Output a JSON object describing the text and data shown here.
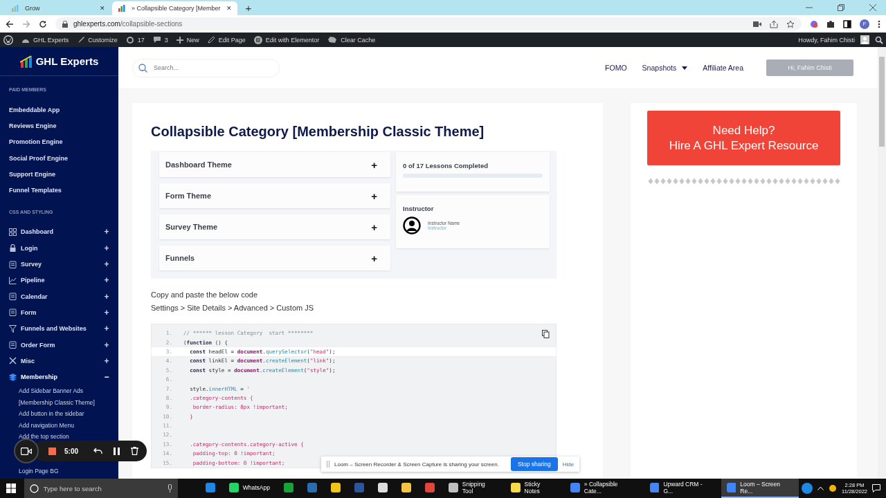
{
  "browser": {
    "tabs": [
      {
        "title": "Grow",
        "close": "✕",
        "selected": false
      },
      {
        "title": "» Collapsible Category [Member",
        "close": "✕",
        "selected": true
      }
    ],
    "new_tab": "+",
    "url": {
      "host": "ghlexperts.com",
      "path": "/collapsible-sections"
    },
    "profile_initial": "F"
  },
  "admin_bar": {
    "items": [
      {
        "label": "GHL Experts"
      },
      {
        "label": "Customize"
      },
      {
        "label": "17"
      },
      {
        "label": "3"
      },
      {
        "label": "New"
      },
      {
        "label": "Edit Page"
      },
      {
        "label": "Edit with Elementor"
      },
      {
        "label": "Clear Cache"
      }
    ],
    "greeting": "Howdy, Fahim Chisti"
  },
  "sidebar": {
    "logo": "GHL Experts",
    "sections": [
      {
        "heading": "PAID MEMBERS",
        "items": [
          {
            "label": "Embeddable App",
            "selected": false
          },
          {
            "label": "Reviews Engine",
            "selected": false
          },
          {
            "label": "Promotion Engine",
            "selected": false
          },
          {
            "label": "Social Proof Engine",
            "selected": false
          },
          {
            "label": "Support Engine",
            "selected": false
          },
          {
            "label": "Funnel Templates",
            "selected": false
          }
        ]
      },
      {
        "heading": "CSS AND STYLING",
        "items": [
          {
            "label": "Dashboard",
            "selected": false,
            "expanded": false,
            "toggle": "+"
          },
          {
            "label": "Login",
            "selected": false,
            "expanded": false,
            "toggle": "+"
          },
          {
            "label": "Survey",
            "selected": false,
            "expanded": false,
            "toggle": "+"
          },
          {
            "label": "Pipeline",
            "selected": false,
            "expanded": false,
            "toggle": "+"
          },
          {
            "label": "Calendar",
            "selected": false,
            "expanded": false,
            "toggle": "+"
          },
          {
            "label": "Form",
            "selected": false,
            "expanded": false,
            "toggle": "+"
          },
          {
            "label": "Funnels and Websites",
            "selected": false,
            "expanded": false,
            "toggle": "+"
          },
          {
            "label": "Order Form",
            "selected": false,
            "expanded": false,
            "toggle": "+"
          },
          {
            "label": "Misc",
            "selected": false,
            "expanded": false,
            "toggle": "+"
          },
          {
            "label": "Membership",
            "selected": true,
            "expanded": true,
            "toggle": "−",
            "children": [
              {
                "label": "Add Sidebar Banner Ads"
              },
              {
                "label": "[Membership Classic Theme]"
              },
              {
                "label": "Add button in the sidebar"
              },
              {
                "label": "Add navigation Menu"
              },
              {
                "label": "Add the top section"
              }
            ],
            "more": [
              {
                "label": "Login Page BG"
              }
            ]
          }
        ]
      }
    ]
  },
  "header": {
    "search": {
      "placeholder": "Search..."
    },
    "nav": [
      {
        "label": "FOMO",
        "dropdown": false
      },
      {
        "label": "Snapshots",
        "dropdown": true
      },
      {
        "label": "Affiliate Area",
        "dropdown": false
      }
    ],
    "account_button": {
      "label": "Hi, Fahim Chisti",
      "disabled": true
    }
  },
  "article": {
    "title": "Collapsible Category [Membership Classic Theme]",
    "preview": {
      "categories": [
        {
          "label": "Dashboard Theme",
          "toggle": "+"
        },
        {
          "label": "Form Theme",
          "toggle": "+"
        },
        {
          "label": "Survey Theme",
          "toggle": "+"
        },
        {
          "label": "Funnels",
          "toggle": "+"
        }
      ],
      "progress": {
        "label": "0 of 17 Lessons Completed",
        "level": 0
      },
      "instructor": {
        "heading": "Instructor",
        "name": "Instructor Name",
        "role": "Instructor"
      }
    },
    "instructions": [
      "Copy and paste the below code",
      "Settings > Site Details > Advanced > Custom JS"
    ],
    "code": [
      {
        "no": "1.",
        "highlighted": false,
        "tokens": [
          {
            "kind": "comment",
            "t": "// ****** lesson Category  start ********"
          }
        ]
      },
      {
        "no": "2.",
        "highlighted": false,
        "tokens": [
          {
            "kind": "plain",
            "t": "("
          },
          {
            "kind": "kw",
            "t": "function"
          },
          {
            "kind": "plain",
            "t": " () {"
          }
        ]
      },
      {
        "no": "3.",
        "highlighted": true,
        "tokens": [
          {
            "kind": "kw",
            "t": "  const"
          },
          {
            "kind": "plain",
            "t": " headEl = "
          },
          {
            "kind": "obj",
            "t": "document"
          },
          {
            "kind": "plain",
            "t": "."
          },
          {
            "kind": "fn",
            "t": "querySelector"
          },
          {
            "kind": "plain",
            "t": "("
          },
          {
            "kind": "str",
            "t": "\"head\""
          },
          {
            "kind": "plain",
            "t": ");"
          }
        ]
      },
      {
        "no": "4.",
        "highlighted": false,
        "tokens": [
          {
            "kind": "kw",
            "t": "  const"
          },
          {
            "kind": "plain",
            "t": " linkEl = "
          },
          {
            "kind": "obj",
            "t": "document"
          },
          {
            "kind": "plain",
            "t": "."
          },
          {
            "kind": "fn",
            "t": "createElement"
          },
          {
            "kind": "plain",
            "t": "("
          },
          {
            "kind": "str",
            "t": "\"link\""
          },
          {
            "kind": "plain",
            "t": ");"
          }
        ]
      },
      {
        "no": "5.",
        "highlighted": false,
        "tokens": [
          {
            "kind": "kw",
            "t": "  const"
          },
          {
            "kind": "plain",
            "t": " style = "
          },
          {
            "kind": "obj",
            "t": "document"
          },
          {
            "kind": "plain",
            "t": "."
          },
          {
            "kind": "fn",
            "t": "createElement"
          },
          {
            "kind": "plain",
            "t": "("
          },
          {
            "kind": "str",
            "t": "\"style\""
          },
          {
            "kind": "plain",
            "t": ");"
          }
        ]
      },
      {
        "no": "6.",
        "highlighted": false
      },
      {
        "no": "7.",
        "highlighted": false,
        "tokens": [
          {
            "kind": "plain",
            "t": "  style."
          },
          {
            "kind": "fn",
            "t": "innerHTML"
          },
          {
            "kind": "plain",
            "t": " = "
          },
          {
            "kind": "str",
            "t": "'"
          }
        ]
      },
      {
        "no": "8.",
        "highlighted": false,
        "tokens": [
          {
            "kind": "str",
            "t": "  .category-contents {"
          }
        ]
      },
      {
        "no": "9.",
        "highlighted": false,
        "tokens": [
          {
            "kind": "str",
            "t": "   border-radius: 8px !important;"
          }
        ]
      },
      {
        "no": "10.",
        "highlighted": false,
        "tokens": [
          {
            "kind": "str",
            "t": "  }"
          }
        ]
      },
      {
        "no": "11.",
        "highlighted": false
      },
      {
        "no": "12.",
        "highlighted": false
      },
      {
        "no": "13.",
        "highlighted": false,
        "tokens": [
          {
            "kind": "str",
            "t": "  .category-contents.category-active {"
          }
        ]
      },
      {
        "no": "14.",
        "highlighted": false,
        "tokens": [
          {
            "kind": "str",
            "t": "   padding-top: 0 !important;"
          }
        ]
      },
      {
        "no": "15.",
        "highlighted": false,
        "tokens": [
          {
            "kind": "str",
            "t": "   padding-bottom: 0 !important;"
          }
        ]
      }
    ]
  },
  "help_card": {
    "lines": [
      "Need Help?",
      "Hire A GHL Expert Resource"
    ]
  },
  "recorder": {
    "timer": "5:00"
  },
  "share_banner": {
    "message": "Loom – Screen Recorder & Screen Capture is sharing your screen.",
    "stop": "Stop sharing",
    "hide": "Hide"
  },
  "taskbar": {
    "search": {
      "placeholder": "Type here to search"
    },
    "apps": [
      {
        "selected": false
      },
      {
        "label": "WhatsApp",
        "selected": false
      },
      {
        "selected": false
      },
      {
        "selected": false
      },
      {
        "selected": false
      },
      {
        "selected": false
      },
      {
        "selected": false
      },
      {
        "selected": false
      },
      {
        "selected": false
      },
      {
        "label": "Snipping Tool",
        "selected": false
      },
      {
        "label": "Sticky Notes",
        "selected": false
      },
      {
        "label": "» Collapsible Cate...",
        "selected": false
      },
      {
        "label": "Upward CRM - G...",
        "selected": false
      },
      {
        "label": "Loom – Screen Re...",
        "selected": true
      }
    ],
    "time": "2:28 PM",
    "date": "11/28/2022"
  }
}
